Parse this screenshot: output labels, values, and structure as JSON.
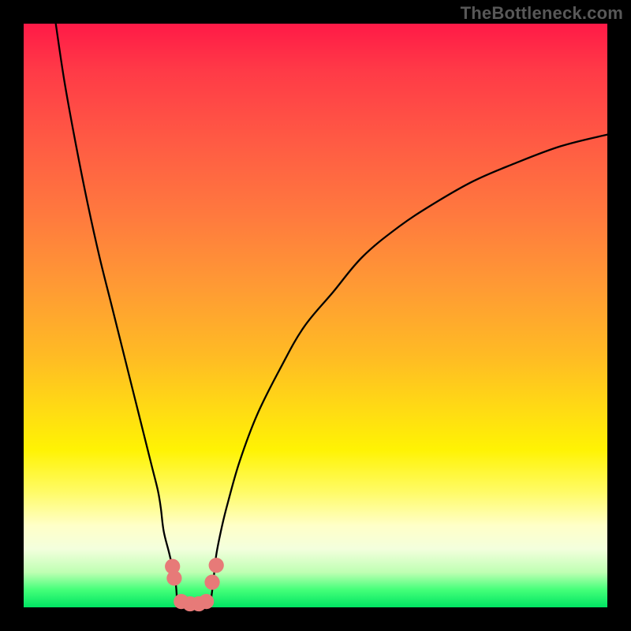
{
  "watermark_text": "TheBottleneck.com",
  "colors": {
    "background": "#000000",
    "gradient_top": "#ff1a47",
    "gradient_bottom": "#00e463",
    "curve_stroke": "#000000",
    "dot_fill": "#e77a78",
    "watermark": "#585858"
  },
  "chart_data": {
    "type": "line",
    "title": "",
    "xlabel": "",
    "ylabel": "",
    "xlim": [
      0,
      100
    ],
    "ylim": [
      0,
      100
    ],
    "series": [
      {
        "name": "left-branch",
        "x": [
          5.5,
          7,
          9,
          11,
          13,
          15,
          17,
          19,
          20,
          21,
          22,
          23,
          23.5,
          24,
          25,
          26,
          26.3
        ],
        "values": [
          100,
          90,
          79,
          69,
          60,
          52,
          44,
          36,
          32,
          28,
          24,
          20,
          17,
          13,
          9,
          4.5,
          0.5
        ]
      },
      {
        "name": "right-branch",
        "x": [
          32.0,
          32.5,
          33,
          34,
          35,
          37,
          40,
          44,
          48,
          53,
          58,
          64,
          70,
          77,
          84,
          92,
          100
        ],
        "values": [
          0.5,
          4.5,
          9,
          14,
          18,
          25,
          33,
          41,
          48,
          54,
          60,
          65,
          69,
          73,
          76,
          79,
          81
        ]
      }
    ],
    "flat_segment": {
      "x": [
        26.3,
        32.0
      ],
      "y": 0.5
    },
    "markers": [
      {
        "x": 25.5,
        "y": 7,
        "r": 1.3
      },
      {
        "x": 25.8,
        "y": 5,
        "r": 1.3
      },
      {
        "x": 27.0,
        "y": 1,
        "r": 1.3
      },
      {
        "x": 28.5,
        "y": 0.6,
        "r": 1.3
      },
      {
        "x": 30.0,
        "y": 0.6,
        "r": 1.3
      },
      {
        "x": 31.3,
        "y": 1,
        "r": 1.3
      },
      {
        "x": 32.3,
        "y": 4.3,
        "r": 1.3
      },
      {
        "x": 33.0,
        "y": 7.2,
        "r": 1.3
      }
    ]
  }
}
